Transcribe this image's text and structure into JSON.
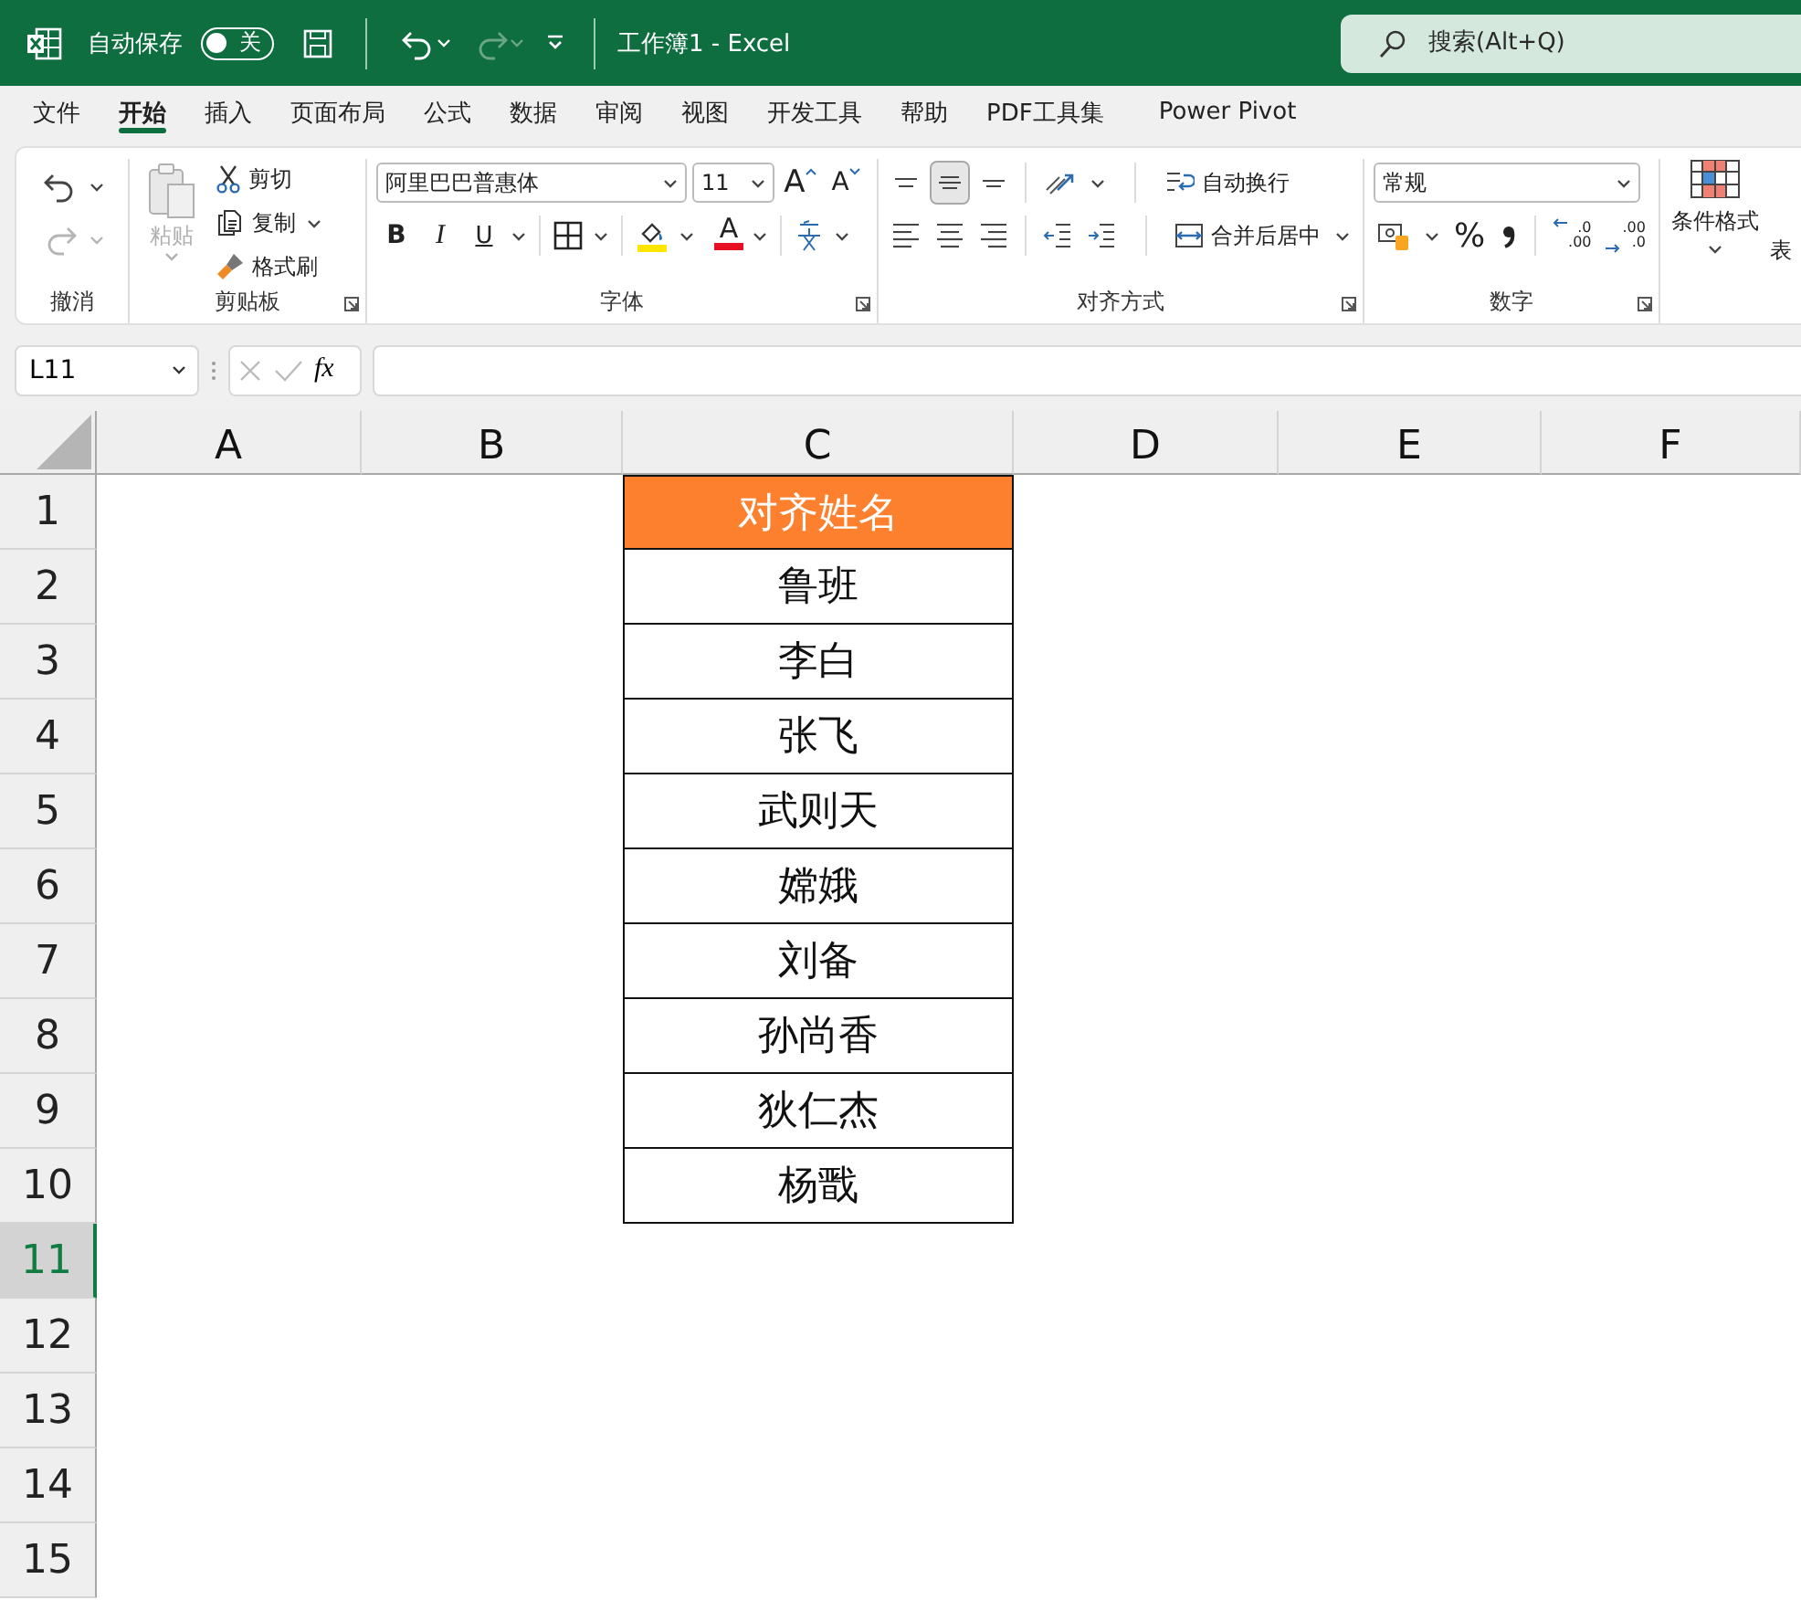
{
  "title_bar": {
    "autosave_label": "自动保存",
    "autosave": {
      "on": false,
      "label": "关"
    },
    "quick_access": [
      {
        "kind": "save",
        "disabled": false
      },
      {
        "kind": "undo",
        "disabled": false
      },
      {
        "kind": "redo",
        "disabled": true
      },
      {
        "kind": "customize",
        "disabled": false
      }
    ],
    "title": "工作簿1 - Excel",
    "search": {
      "placeholder": "搜索(Alt+Q)"
    }
  },
  "menu_tabs": [
    {
      "label": "文件",
      "selected": false
    },
    {
      "label": "开始",
      "selected": true
    },
    {
      "label": "插入",
      "selected": false
    },
    {
      "label": "页面布局",
      "selected": false
    },
    {
      "label": "公式",
      "selected": false
    },
    {
      "label": "数据",
      "selected": false
    },
    {
      "label": "审阅",
      "selected": false
    },
    {
      "label": "视图",
      "selected": false
    },
    {
      "label": "开发工具",
      "selected": false
    },
    {
      "label": "帮助",
      "selected": false
    },
    {
      "label": "PDF工具集",
      "selected": false
    },
    {
      "label": "Power Pivot",
      "selected": false
    }
  ],
  "ribbon": {
    "undo_group": {
      "label": "撤消",
      "undo_disabled": false,
      "redo_disabled": true
    },
    "clipboard": {
      "label": "剪贴板",
      "paste": {
        "label": "粘贴",
        "disabled": true
      },
      "cut": "剪切",
      "copy": "复制",
      "format_painter": "格式刷"
    },
    "font": {
      "label": "字体",
      "font_name": "阿里巴巴普惠体",
      "font_size": "11",
      "grow": "A",
      "shrink": "A",
      "bold": "B",
      "italic": "I",
      "underline": "U",
      "font_color": "A"
    },
    "alignment": {
      "label": "对齐方式",
      "vertical": [
        {
          "kind": "top",
          "selected": false
        },
        {
          "kind": "middle",
          "selected": true
        },
        {
          "kind": "bottom",
          "selected": false
        }
      ],
      "horizontal": [
        {
          "kind": "left",
          "selected": false
        },
        {
          "kind": "center",
          "selected": false
        },
        {
          "kind": "right",
          "selected": false
        }
      ],
      "wrap_text": "自动换行",
      "merge_center": "合并后居中"
    },
    "number": {
      "label": "数字",
      "format": "常规",
      "percent": "%",
      "increase_decimal": [
        ".0",
        ".00"
      ],
      "decrease_decimal": [
        ".00",
        ".0"
      ]
    },
    "styles": {
      "conditional_format": "条件格式",
      "next_cut": "表"
    }
  },
  "formula_bar": {
    "name_box": "L11",
    "fx": "fx"
  },
  "sheet": {
    "columns": [
      "A",
      "B",
      "C",
      "D",
      "E",
      "F"
    ],
    "rows": [
      {
        "label": "1",
        "selected": false,
        "column_c": {
          "text": "对齐姓名",
          "kind": "header"
        }
      },
      {
        "label": "2",
        "selected": false,
        "column_c": {
          "text": "鲁班",
          "kind": "name"
        }
      },
      {
        "label": "3",
        "selected": false,
        "column_c": {
          "text": "李白",
          "kind": "name"
        }
      },
      {
        "label": "4",
        "selected": false,
        "column_c": {
          "text": "张飞",
          "kind": "name"
        }
      },
      {
        "label": "5",
        "selected": false,
        "column_c": {
          "text": "武则天",
          "kind": "name"
        }
      },
      {
        "label": "6",
        "selected": false,
        "column_c": {
          "text": "嫦娥",
          "kind": "name"
        }
      },
      {
        "label": "7",
        "selected": false,
        "column_c": {
          "text": "刘备",
          "kind": "name"
        }
      },
      {
        "label": "8",
        "selected": false,
        "column_c": {
          "text": "孙尚香",
          "kind": "name"
        }
      },
      {
        "label": "9",
        "selected": false,
        "column_c": {
          "text": "狄仁杰",
          "kind": "name"
        }
      },
      {
        "label": "10",
        "selected": false,
        "column_c": {
          "text": "杨戬",
          "kind": "name"
        }
      },
      {
        "label": "11",
        "selected": true
      },
      {
        "label": "12",
        "selected": false
      },
      {
        "label": "13",
        "selected": false
      },
      {
        "label": "14",
        "selected": false
      },
      {
        "label": "15",
        "selected": false
      }
    ]
  }
}
